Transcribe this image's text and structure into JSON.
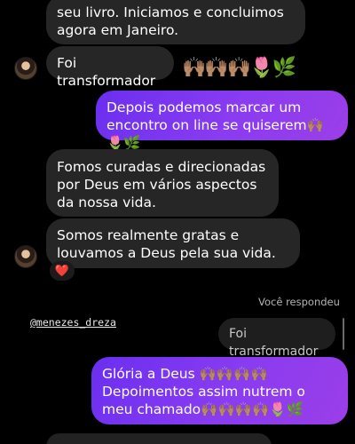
{
  "messages": [
    {
      "id": "m1",
      "side": "in",
      "text": "seu livro. Iniciamos e concluimos agora em Janeiro."
    },
    {
      "id": "m2",
      "side": "in",
      "text": "Foi transformador"
    },
    {
      "id": "m2_emoji",
      "text": "🙌🏽🙌🏽🙌🏽🌷🌿"
    },
    {
      "id": "m3",
      "side": "out",
      "text": "Depois podemos marcar um encontro on line se  quiserem🙌🏽🌷🌿"
    },
    {
      "id": "m4",
      "side": "in",
      "text": "Fomos curadas e direcionadas por Deus em vários aspectos da nossa vida."
    },
    {
      "id": "m5",
      "side": "in",
      "text": "Somos realmente gratas e louvamos a Deus pela sua vida."
    },
    {
      "id": "m5_reaction",
      "text": "❤️"
    },
    {
      "id": "m7",
      "side": "out",
      "text": "Glória a Deus 🙌🏽🙌🏽🙌🏽🙌🏽Depoimentos assim nutrem o meu chamado🙌🏽🙌🏽🙌🏽🙌🏽🌷🌿"
    }
  ],
  "reply": {
    "meta": "Você respondeu",
    "handle": "@menezes_dreza",
    "quoted_text": "Foi transformador"
  }
}
